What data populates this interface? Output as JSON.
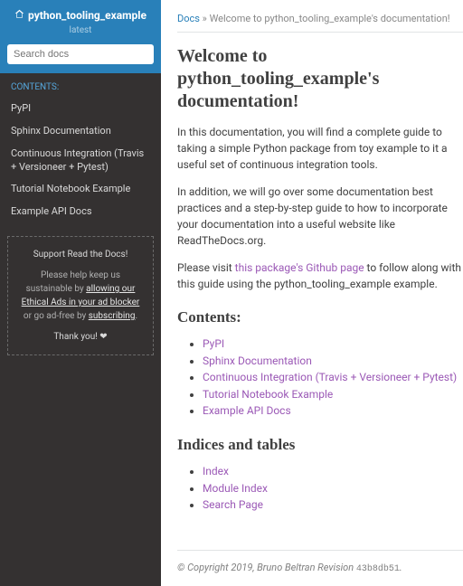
{
  "sidebar": {
    "title": "python_tooling_example",
    "version": "latest",
    "search_placeholder": "Search docs",
    "caption": "CONTENTS:",
    "items": [
      {
        "label": "PyPI"
      },
      {
        "label": "Sphinx Documentation"
      },
      {
        "label": "Continuous Integration (Travis + Versioneer + Pytest)"
      },
      {
        "label": "Tutorial Notebook Example"
      },
      {
        "label": "Example API Docs"
      }
    ],
    "ad": {
      "title": "Support Read the Docs!",
      "lead": "Please help keep us sustainable by ",
      "link1": "allowing our Ethical Ads in your ad blocker",
      "mid": " or go ad-free by ",
      "link2": "subscribing",
      "tail": ".",
      "thanks": "Thank you! ❤"
    }
  },
  "breadcrumb": {
    "root": "Docs",
    "sep": " » ",
    "current": "Welcome to python_tooling_example's documentation!"
  },
  "page": {
    "h1": "Welcome to python_tooling_example's documentation!",
    "p1": "In this documentation, you will find a complete guide to taking a simple Python package from toy example to it a useful set of continuous integration tools.",
    "p2": "In addition, we will go over some documentation best practices and a step-by-step guide to how to incorporate your documentation into a useful website like ReadTheDocs.org.",
    "p3a": "Please visit ",
    "p3_link": "this package's Github page",
    "p3b": " to follow along with this guide using the python_tooling_example example.",
    "contents_h": "Contents:",
    "contents": [
      "PyPI",
      "Sphinx Documentation",
      "Continuous Integration (Travis + Versioneer + Pytest)",
      "Tutorial Notebook Example",
      "Example API Docs"
    ],
    "indices_h": "Indices and tables",
    "indices": [
      "Index",
      "Module Index",
      "Search Page"
    ]
  },
  "footer": {
    "text": "© Copyright 2019, Bruno Beltran Revision ",
    "rev": "43b8db51",
    "tail": "."
  }
}
